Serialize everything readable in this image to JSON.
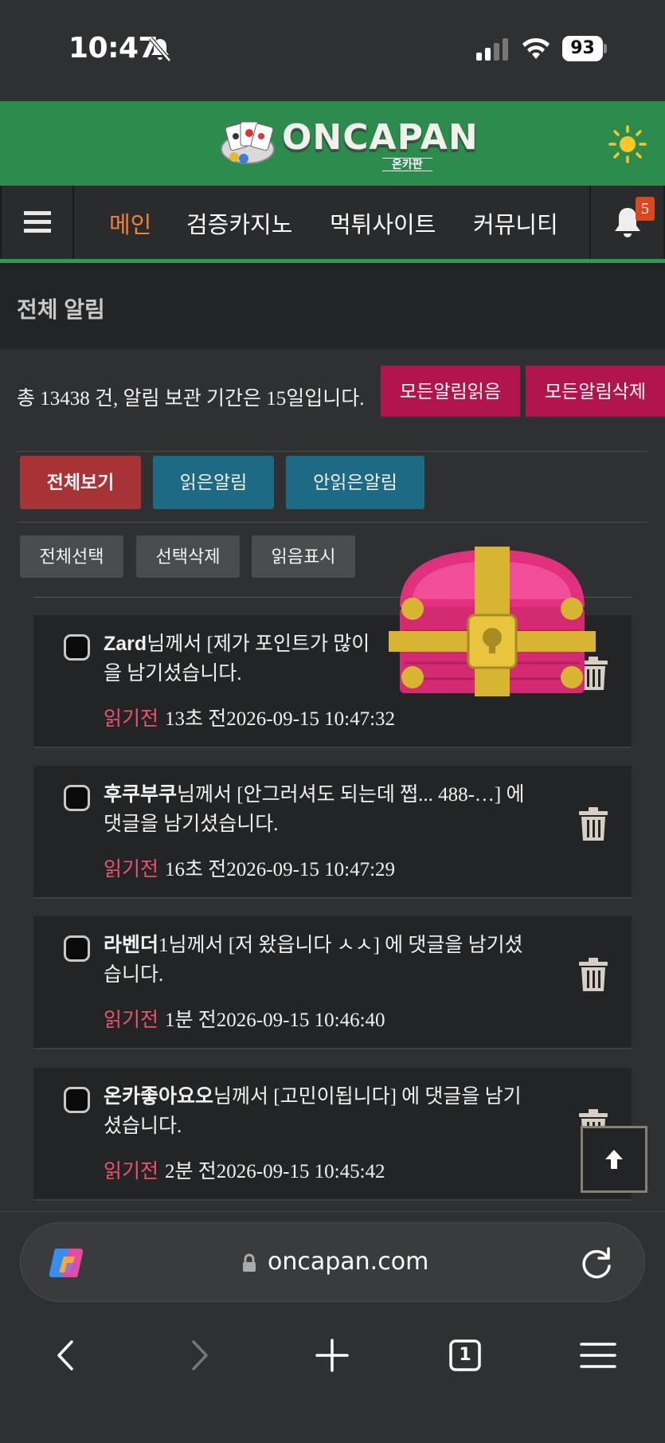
{
  "status_bar": {
    "time": "10:47",
    "battery": "93"
  },
  "header": {
    "logo_text": "ONCAPAN",
    "logo_sub": "온카판"
  },
  "nav": {
    "items": [
      {
        "label": "메인",
        "active": true
      },
      {
        "label": "검증카지노",
        "active": false
      },
      {
        "label": "먹튀사이트",
        "active": false
      },
      {
        "label": "커뮤니티",
        "active": false
      }
    ],
    "notification_count": "5"
  },
  "page": {
    "title": "전체 알림",
    "summary": "총 13438 건, 알림 보관 기간은 15일입니다.",
    "read_all_button": "모든알림읽음",
    "delete_all_button": "모든알림삭제"
  },
  "filters": {
    "all": "전체보기",
    "read": "읽은알림",
    "unread": "안읽은알림"
  },
  "actions": {
    "select_all": "전체선택",
    "delete_selected": "선택삭제",
    "mark_read": "읽음표시"
  },
  "notifications": [
    {
      "nick": "Zard",
      "body_line1": "님께서 [제가 포인트가 많이 ",
      "body_line2": "을 남기셨습니다.",
      "status": "읽기전",
      "time": "13초 전2026-09-15 10:47:32"
    },
    {
      "nick": "후쿠부쿠",
      "body_line1": "님께서 [안그러셔도 되는데 쩝... 488-…] 에",
      "body_line2": "댓글을 남기셨습니다.",
      "status": "읽기전",
      "time": "16초 전2026-09-15 10:47:29"
    },
    {
      "nick": "라벤더",
      "body_line1": "1님께서 [저 왔읍니다 ㅅㅅ] 에 댓글을 남기셨",
      "body_line2": "습니다.",
      "status": "읽기전",
      "time": "1분 전2026-09-15 10:46:40"
    },
    {
      "nick": "온카좋아요오",
      "body_line1": "님께서 [고민이됩니다] 에 댓글을 남기",
      "body_line2": "셨습니다.",
      "status": "읽기전",
      "time": "2분 전2026-09-15 10:45:42"
    }
  ],
  "browser": {
    "url": "oncapan.com",
    "tab_count": "1"
  },
  "colors": {
    "header_green": "#2e8b4e",
    "active_orange": "#f0803a",
    "crimson": "#b2154b",
    "teal": "#1c6a84",
    "unread_pink": "#e8546c"
  }
}
